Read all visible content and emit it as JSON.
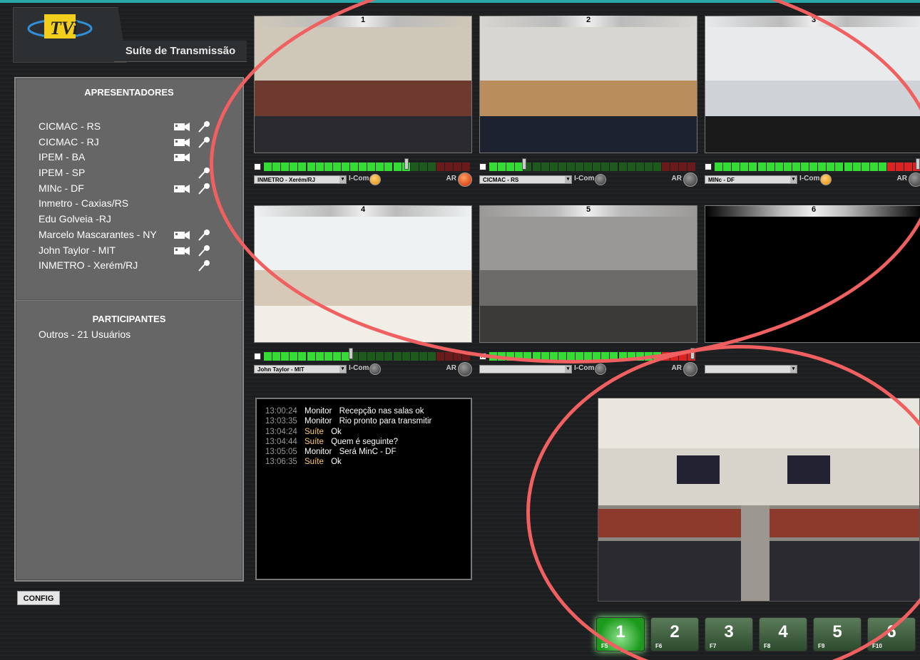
{
  "app": {
    "logo_text": "TVi",
    "suite_label": "Suíte de Transmissão"
  },
  "left_panel": {
    "presenters_title": "APRESENTADORES",
    "presenters": [
      {
        "name": "CICMAC - RS",
        "camera": true,
        "mic": true
      },
      {
        "name": "CICMAC - RJ",
        "camera": true,
        "mic": true
      },
      {
        "name": "IPEM - BA",
        "camera": true,
        "mic": false
      },
      {
        "name": "IPEM - SP",
        "camera": false,
        "mic": true
      },
      {
        "name": "MINc - DF",
        "camera": true,
        "mic": true
      },
      {
        "name": "Inmetro - Caxias/RS",
        "camera": false,
        "mic": false
      },
      {
        "name": "Edu Golveia -RJ",
        "camera": false,
        "mic": false
      },
      {
        "name": "Marcelo Mascarantes - NY",
        "camera": true,
        "mic": true
      },
      {
        "name": "John Taylor - MIT",
        "camera": true,
        "mic": true
      },
      {
        "name": "INMETRO - Xerém/RJ",
        "camera": false,
        "mic": true
      }
    ],
    "participants_title": "PARTICIPANTES",
    "participants_text": "Outros - 21 Usuários",
    "config_label": "CONFIG"
  },
  "cameras": [
    {
      "num": "1",
      "source": "INMETRO - Xerém/RJ",
      "icom_label": "I-Com",
      "ar_label": "AR",
      "icom_active": true,
      "ar_active": true,
      "level": 0.68,
      "checked": false
    },
    {
      "num": "2",
      "source": "CICMAC - RS",
      "icom_label": "I-Com",
      "ar_label": "AR",
      "icom_active": false,
      "ar_active": false,
      "level": 0.16,
      "checked": false
    },
    {
      "num": "3",
      "source": "MINc - DF",
      "icom_label": "I-Com",
      "ar_label": "AR",
      "icom_active": true,
      "ar_active": false,
      "level": 0.98,
      "checked": false
    },
    {
      "num": "4",
      "source": "John Taylor - MIT",
      "icom_label": "I-Com",
      "ar_label": "AR",
      "icom_active": false,
      "ar_active": false,
      "level": 0.41,
      "checked": false
    },
    {
      "num": "5",
      "source": "",
      "icom_label": "I-Com",
      "ar_label": "AR",
      "icom_active": false,
      "ar_active": false,
      "level": 0.98,
      "checked": true
    },
    {
      "num": "6",
      "source": "",
      "icom_label": "I-Com",
      "ar_label": "AR",
      "icom_active": false,
      "ar_active": false,
      "level": 0,
      "checked": false
    }
  ],
  "chat": [
    {
      "time": "13:00:24",
      "who": "Monitor",
      "type": "monitor",
      "msg": "Recepção nas salas ok"
    },
    {
      "time": "13:03:35",
      "who": "Monitor",
      "type": "monitor",
      "msg": "Rio pronto para transmitir"
    },
    {
      "time": "13:04:24",
      "who": "Suíte",
      "type": "suite",
      "msg": "Ok"
    },
    {
      "time": "13:04:44",
      "who": "Suíte",
      "type": "suite",
      "msg": "Quem é seguinte?"
    },
    {
      "time": "13:05:05",
      "who": "Monitor",
      "type": "monitor",
      "msg": " Será MinC - DF"
    },
    {
      "time": "13:06:35",
      "who": "Suíte",
      "type": "suite",
      "msg": "Ok"
    }
  ],
  "function_keys": [
    {
      "label": "1",
      "fkey": "F5",
      "active": true
    },
    {
      "label": "2",
      "fkey": "F6",
      "active": false
    },
    {
      "label": "3",
      "fkey": "F7",
      "active": false
    },
    {
      "label": "4",
      "fkey": "F8",
      "active": false
    },
    {
      "label": "5",
      "fkey": "F9",
      "active": false
    },
    {
      "label": "6",
      "fkey": "F10",
      "active": false
    }
  ],
  "colors": {
    "accent_teal": "#2aa8a8",
    "annotation_red": "#f06060",
    "meter_green": "#33dd33",
    "meter_red": "#dd2222"
  }
}
